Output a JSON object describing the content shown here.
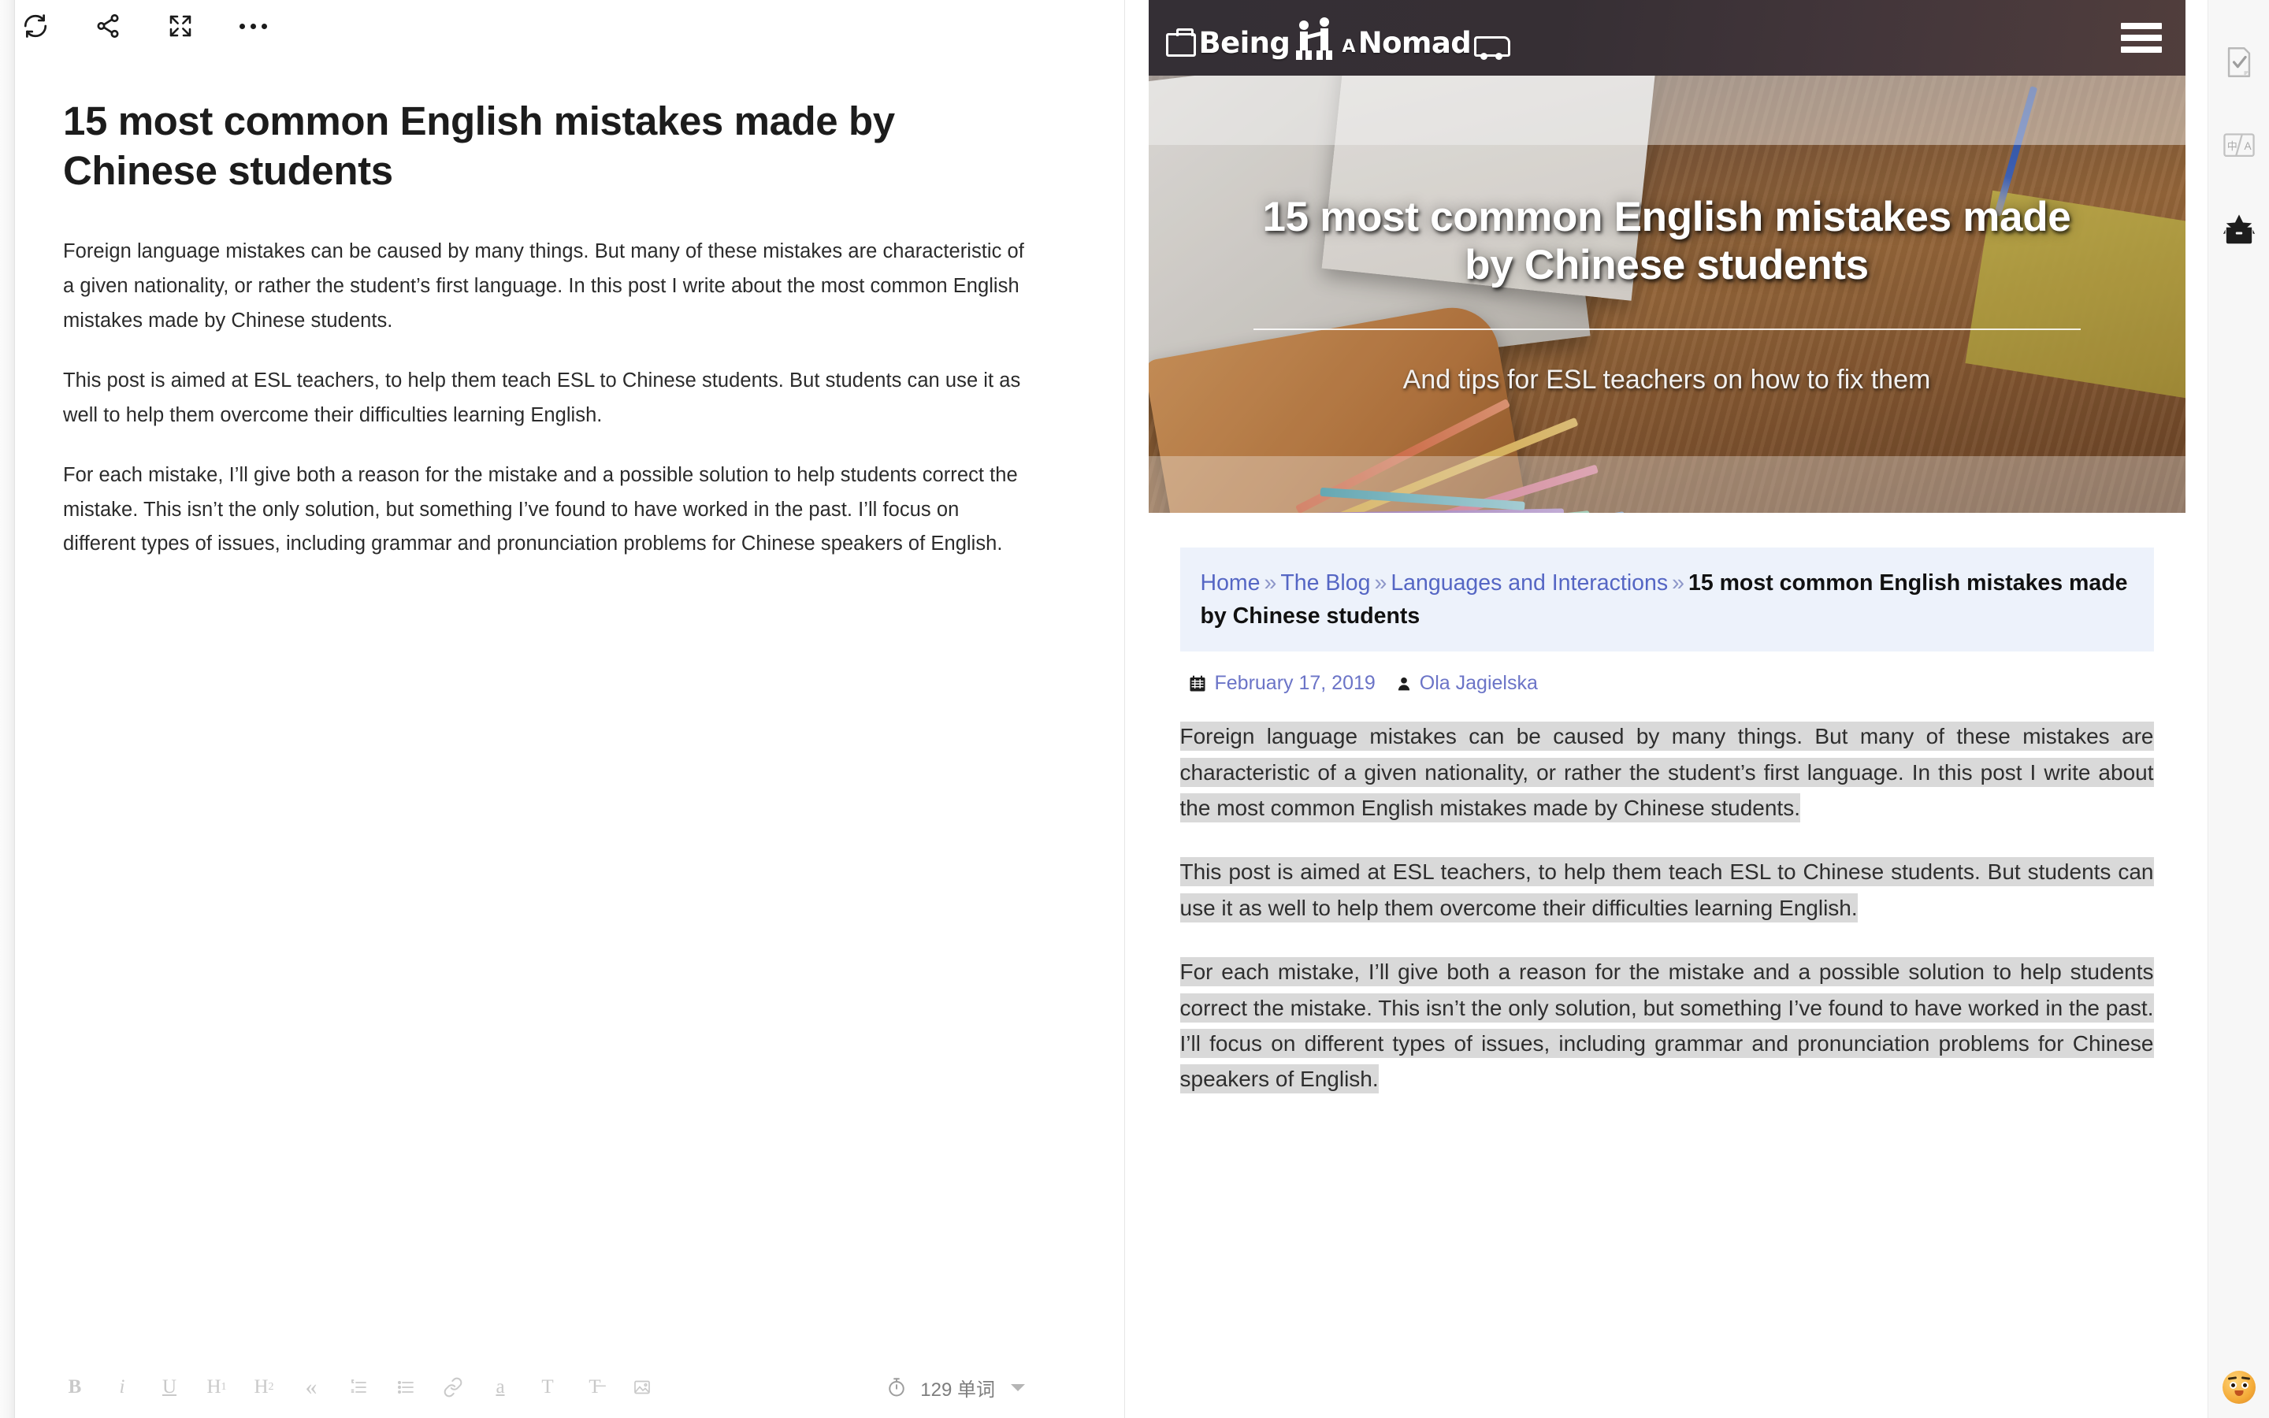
{
  "editor": {
    "toolbar": {
      "sync_label": "Sync",
      "share_label": "Share",
      "fullscreen_label": "Fullscreen",
      "more_label": "More"
    },
    "document": {
      "title": "15 most common English mistakes made by Chinese students",
      "paragraphs": [
        "Foreign language mistakes can be caused by many things. But many of these mistakes are characteristic of a given nationality, or rather the student’s first language. In this post I write about the most common English mistakes made by Chinese students.",
        "This post is aimed at ESL teachers, to help them teach ESL to Chinese students. But students can use it as well to help them overcome their difficulties learning English.",
        "For each mistake, I’ll give both a reason for the mistake and a possible solution to help students correct the mistake. This isn’t the only solution, but something I’ve found to have worked in the past. I’ll focus on different types of issues, including grammar and pronunciation problems for Chinese speakers of English."
      ]
    },
    "format_toolbar": [
      {
        "name": "bold",
        "glyph": "B"
      },
      {
        "name": "italic",
        "glyph": "i"
      },
      {
        "name": "underline",
        "glyph": "U"
      },
      {
        "name": "heading-1",
        "glyph": "H1"
      },
      {
        "name": "heading-2",
        "glyph": "H2"
      },
      {
        "name": "blockquote",
        "glyph": "«"
      },
      {
        "name": "ordered-list",
        "glyph": "≣"
      },
      {
        "name": "unordered-list",
        "glyph": "≡"
      },
      {
        "name": "link",
        "glyph": "🔗"
      },
      {
        "name": "highlight",
        "glyph": "a"
      },
      {
        "name": "text-style",
        "glyph": "T"
      },
      {
        "name": "clear-format",
        "glyph": "T̶"
      },
      {
        "name": "insert-image",
        "glyph": "⛰"
      }
    ],
    "status": {
      "word_count": "129 单词",
      "timer_label": "Timer"
    }
  },
  "preview": {
    "site": {
      "logo_text_1": "Being",
      "logo_text_2": "A",
      "logo_text_3": "Nomad",
      "menu_label": "Menu"
    },
    "hero": {
      "title": "15 most common English mistakes made by Chinese students",
      "subtitle": "And tips for ESL teachers on how to fix them"
    },
    "breadcrumb": {
      "items": [
        {
          "label": "Home",
          "link": true
        },
        {
          "label": "The Blog",
          "link": true
        },
        {
          "label": "Languages and Interactions",
          "link": true
        }
      ],
      "separator": "»",
      "current": "15 most common English mistakes made by Chinese students"
    },
    "meta": {
      "date": "February 17, 2019",
      "author": "Ola Jagielska"
    },
    "paragraphs": [
      "Foreign language mistakes can be caused by many things. But many of these mistakes are characteristic of a given nationality, or rather the student’s first language. In this post I write about the most common English mistakes made by Chinese students.",
      "This post is aimed at ESL teachers, to help them teach ESL to Chinese students. But students can use it as well to help them overcome their difficulties learning English.",
      "For each mistake, I’ll give both a reason for the mistake and a possible solution to help students correct the mistake. This isn’t the only solution, but something I’ve found to have worked in the past. I’ll focus on different types of issues, including grammar and pronunciation problems for Chinese speakers of English."
    ]
  },
  "right_rail": {
    "items": [
      {
        "name": "proofread-check-icon",
        "label": "Proofread"
      },
      {
        "name": "translate-icon",
        "label": "Translate"
      },
      {
        "name": "archive-box-icon",
        "label": "Collections"
      }
    ],
    "emoji_label": "Emoji"
  },
  "colors": {
    "accent_link": "#5566c4",
    "breadcrumb_bg": "#edf2fb",
    "selection_bg": "#d9d9d9",
    "header_bg": "#2e2a30",
    "rail_bg": "#f7f7f7"
  }
}
